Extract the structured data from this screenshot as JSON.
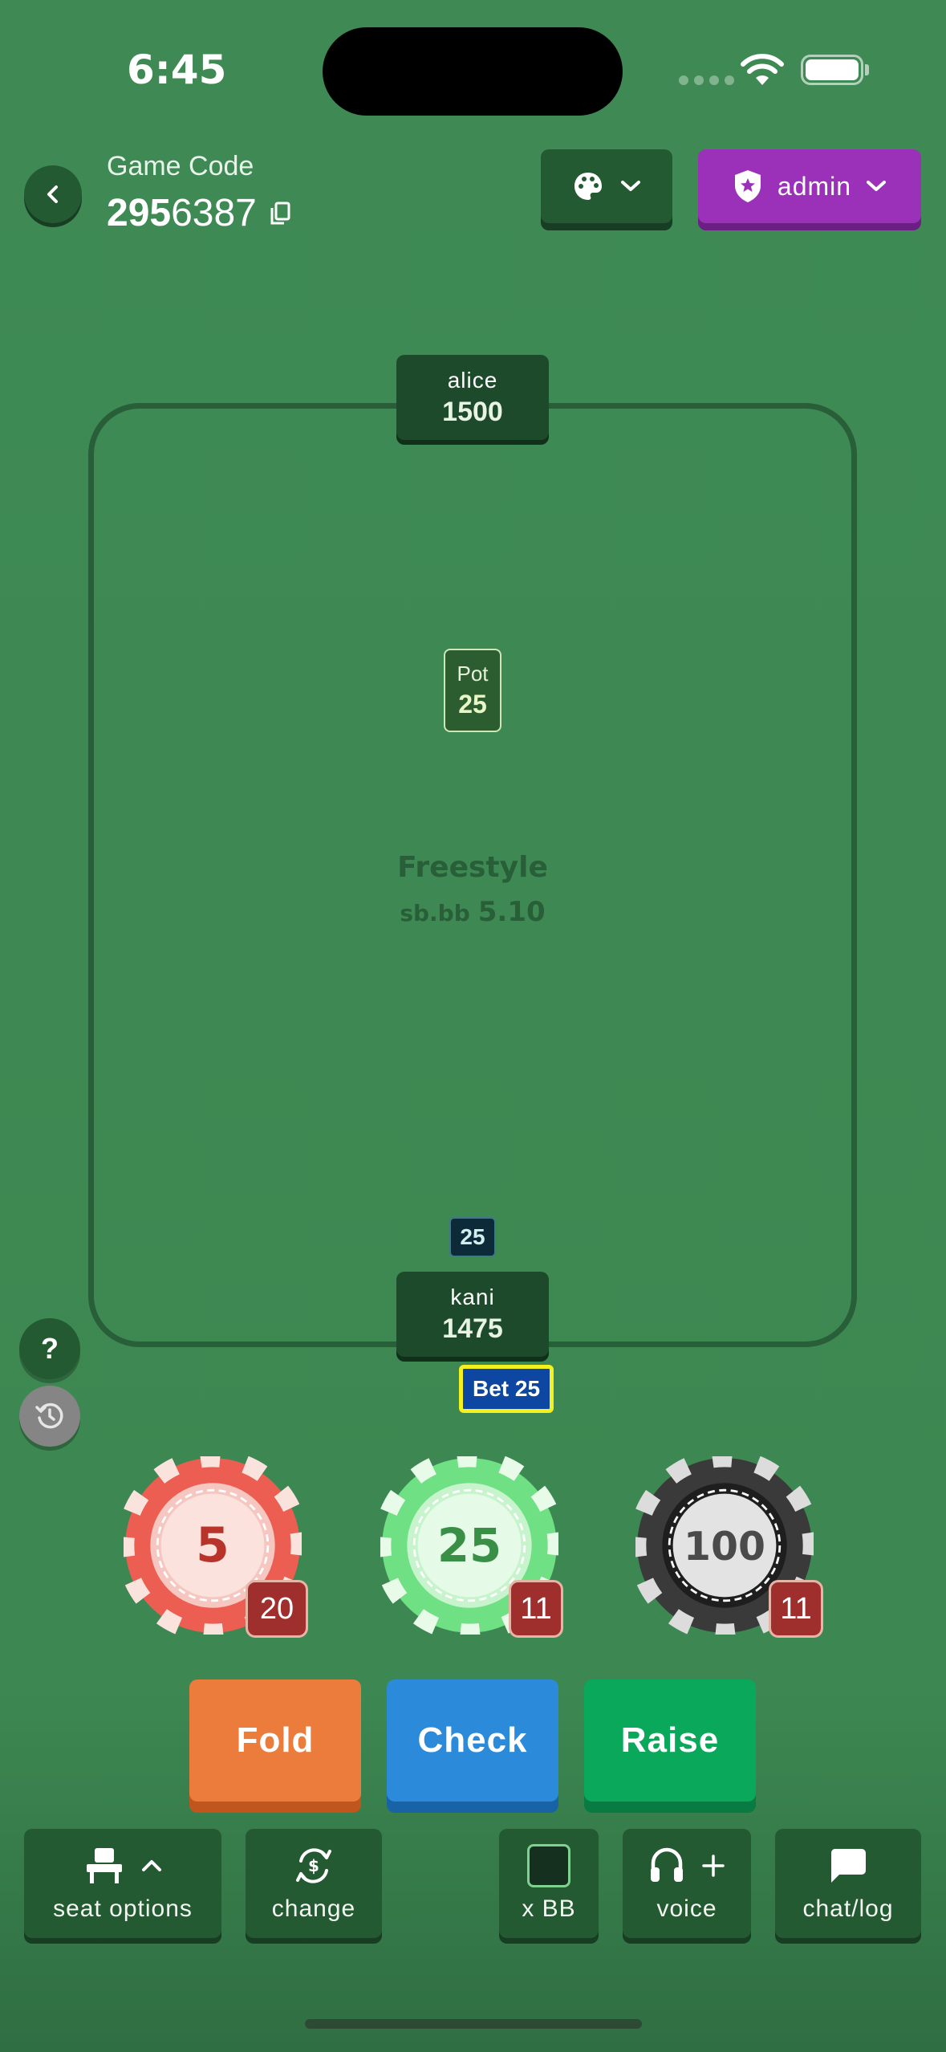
{
  "status_bar": {
    "time": "6:45"
  },
  "header": {
    "game_code_label": "Game Code",
    "game_code_bold": "295",
    "game_code_rest": "6387",
    "admin_label": "admin"
  },
  "table": {
    "players": [
      {
        "name": "alice",
        "stack": "1500"
      },
      {
        "name": "kani",
        "stack": "1475"
      }
    ],
    "pot_label": "Pot",
    "pot_value": "25",
    "game_name": "Freestyle",
    "blinds_label": "sb.bb",
    "blinds_value": "5.10",
    "current_bet": "25",
    "bet_tag": "Bet 25"
  },
  "help_label": "?",
  "chips": [
    {
      "value": "5",
      "count": "20",
      "color": "#ec5e52"
    },
    {
      "value": "25",
      "count": "11",
      "color": "#6fe083"
    },
    {
      "value": "100",
      "count": "11",
      "color": "#3a3a3a"
    }
  ],
  "actions": {
    "fold": "Fold",
    "check": "Check",
    "raise": "Raise"
  },
  "toolbar": {
    "seat_options": "seat options",
    "change": "change",
    "xbb": "x BB",
    "voice": "voice",
    "chat": "chat/log"
  },
  "colors": {
    "felt": "#3f8a54",
    "panel": "#245a32",
    "admin": "#9b31b9",
    "fold": "#ec7c3c",
    "check": "#2b8ad9",
    "raise": "#0aa85a"
  }
}
